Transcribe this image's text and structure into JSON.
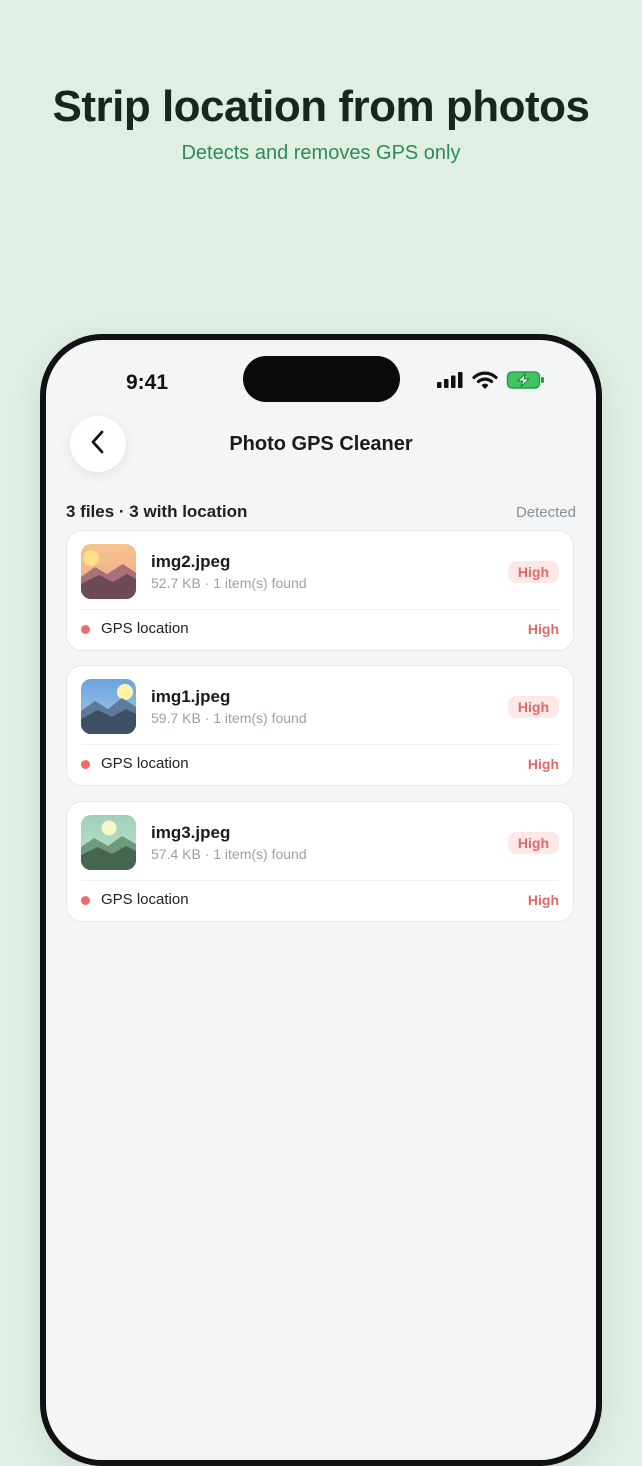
{
  "hero": {
    "title": "Strip location from photos",
    "subtitle": "Detects and removes GPS only"
  },
  "status_bar": {
    "time": "9:41",
    "icons": [
      "cellular-signal-icon",
      "wifi-icon",
      "battery-charging-icon"
    ]
  },
  "nav": {
    "back_icon": "chevron-left-icon",
    "title": "Photo GPS Cleaner"
  },
  "summary": {
    "text": "3 files · 3 with location",
    "status": "Detected"
  },
  "colors": {
    "background": "#dfefe4",
    "headline": "#16281e",
    "accent_green": "#2f8a55",
    "risk_red": "#e06a6a",
    "risk_badge_bg": "#fde8e8"
  },
  "files": [
    {
      "name": "img2.jpeg",
      "meta": "52.7 KB · 1 item(s) found",
      "risk": "High",
      "thumbnail": "sunset-landscape-thumbnail",
      "items": [
        {
          "label": "GPS location",
          "level": "High"
        }
      ]
    },
    {
      "name": "img1.jpeg",
      "meta": "59.7 KB · 1 item(s) found",
      "risk": "High",
      "thumbnail": "blue-mountain-landscape-thumbnail",
      "items": [
        {
          "label": "GPS location",
          "level": "High"
        }
      ]
    },
    {
      "name": "img3.jpeg",
      "meta": "57.4 KB · 1 item(s) found",
      "risk": "High",
      "thumbnail": "green-mountain-landscape-thumbnail",
      "items": [
        {
          "label": "GPS location",
          "level": "High"
        }
      ]
    }
  ]
}
